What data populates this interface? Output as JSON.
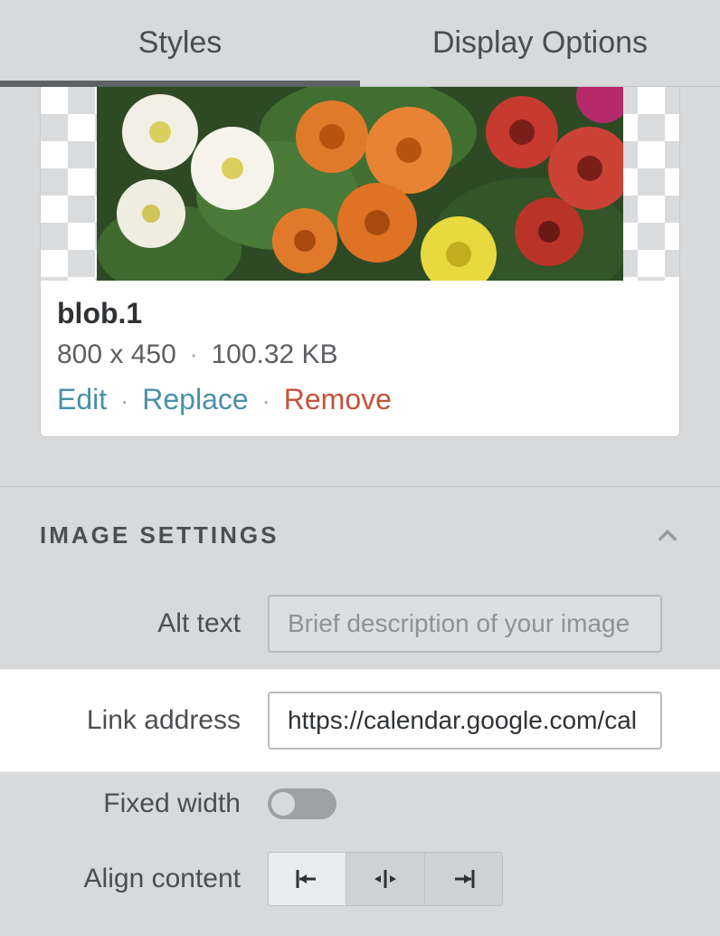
{
  "tabs": {
    "styles": "Styles",
    "display_options": "Display Options",
    "active": "styles"
  },
  "image_card": {
    "filename": "blob.1",
    "dimensions": "800 x 450",
    "filesize": "100.32 KB",
    "actions": {
      "edit": "Edit",
      "replace": "Replace",
      "remove": "Remove"
    }
  },
  "section": {
    "title": "IMAGE SETTINGS"
  },
  "fields": {
    "alt_text": {
      "label": "Alt text",
      "placeholder": "Brief description of your image",
      "value": ""
    },
    "link_address": {
      "label": "Link address",
      "value": "https://calendar.google.com/cal"
    },
    "fixed_width": {
      "label": "Fixed width",
      "value": false
    },
    "align_content": {
      "label": "Align content",
      "value": "left"
    }
  }
}
